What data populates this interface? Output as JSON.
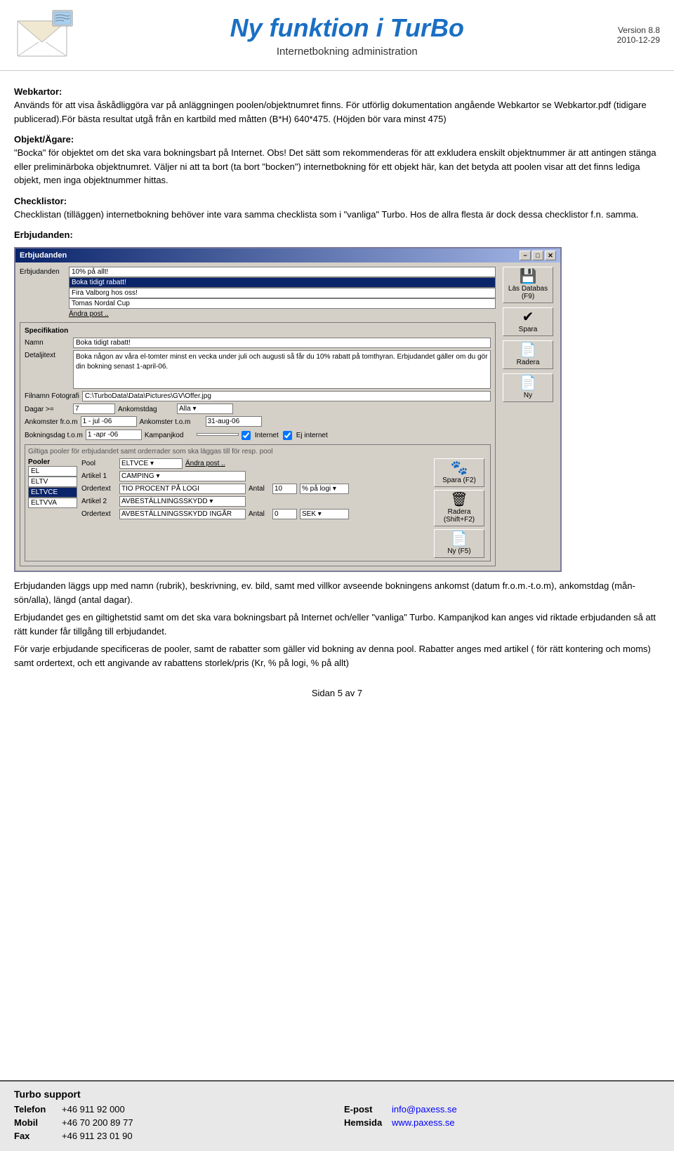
{
  "header": {
    "title": "Ny funktion i TurBo",
    "subtitle": "Internetbokning administration",
    "version_label": "Version 8.8",
    "version_date": "2010-12-29"
  },
  "intro": {
    "webkartor_heading": "Webkartor:",
    "webkartor_p1": "Används för att visa åskådliggöra var på anläggningen poolen/objektnumret finns. För utförlig dokumentation angående Webkartor se Webkartor.pdf (tidigare publicerad).För bästa resultat utgå från en kartbild med måtten (B*H) 640*475. (Höjden bör vara minst 475)",
    "objekt_heading": "Objekt/Ägare:",
    "objekt_p1": "\"Bocka\" för objektet om det ska vara bokningsbart på Internet. Obs! Det sätt som rekommenderas för att exkludera enskilt objektnummer är att antingen stänga eller preliminärboka objektnumret. Väljer ni att ta bort (ta bort \"bocken\") internetbokning för ett objekt här, kan det betyda att poolen visar att det finns lediga objekt, men inga objektnummer hittas.",
    "checklistor_heading": "Checklistor:",
    "checklistor_p1": "Checklistan (tilläggen) internetbokning behöver inte vara samma checklista som i \"vanliga\" Turbo. Hos de allra flesta är dock dessa checklistor f.n. samma.",
    "erbjudanden_heading": "Erbjudanden:"
  },
  "dialog": {
    "title": "Erbjudanden",
    "titlebar_minimize": "−",
    "titlebar_maximize": "□",
    "titlebar_close": "✕",
    "erbjudanden_label": "Erbjudanden",
    "list_items": [
      {
        "text": "10% på allt!",
        "selected": false
      },
      {
        "text": "Boka tidigt rabatt!",
        "selected": true
      },
      {
        "text": "Fira Valborg hos oss!",
        "selected": false
      },
      {
        "text": "Tomas Nordal Cup",
        "selected": false
      }
    ],
    "andrapost": "Ändra post ..",
    "spec_heading": "Specifikation",
    "spec_namn_label": "Namn",
    "spec_namn_value": "Boka tidigt rabatt!",
    "spec_detalj_label": "Detaljitext",
    "spec_detalj_value": "Boka någon av våra el-tomter minst en vecka under juli och augusti så får du 10% rabatt på tomthyran. Erbjudandet gäller om du gör din bokning senast 1-april-06.",
    "spec_filnamn_label": "Filnamn Fotografi",
    "spec_filnamn_value": "C:\\TurboData\\Data\\Pictures\\GV\\Offer.jpg",
    "spec_dagar_label": "Dagar >=",
    "spec_dagar_value": "7",
    "spec_ankomstdag_label": "Ankomstdag",
    "spec_ankomstdag_value": "Alla",
    "spec_ankomst_from_label": "Ankomster fr.o.m",
    "spec_ankomst_from_value": "1 - jul -06",
    "spec_ankomst_tom_label": "Ankomster t.o.m",
    "spec_ankomst_tom_value": "31-aug-06",
    "spec_bokdag_label": "Bokningsdag t.o.m",
    "spec_bokdag_value": "1 -apr -06",
    "spec_kampanj_label": "Kampanjkod",
    "spec_kampanj_value": "",
    "spec_internet_label": "Internet",
    "spec_ejinternet_label": "Ej internet",
    "btn_las_label": "Läs Databas (F9)",
    "btn_spara_label": "Spara",
    "btn_radera_label": "Radera",
    "btn_ny_label": "Ny",
    "pooler_info": "Giltiga pooler för erbjudandet samt orderrader som ska läggas till för resp. pool",
    "pooler_heading": "Pooler",
    "pooler_items": [
      {
        "text": "EL",
        "selected": false
      },
      {
        "text": "ELTV",
        "selected": false
      },
      {
        "text": "ELTVCE",
        "selected": true
      },
      {
        "text": "ELTVVA",
        "selected": false
      }
    ],
    "pool_label": "Pool",
    "pool_value": "ELTVCE",
    "pool_andra": "Ändra post ..",
    "artikel1_label": "Artikel 1",
    "artikel1_value": "CAMPING",
    "ordertext1_label": "Ordertext",
    "ordertext1_value": "TIO PROCENT PÅ LOGI",
    "antal1_label": "Antal",
    "antal1_value": "10",
    "pct1_value": "% på logi",
    "artikel2_label": "Artikel 2",
    "artikel2_value": "AVBESTÄLLNINGSSKYDD",
    "ordertext2_label": "Ordertext",
    "ordertext2_value": "AVBESTÄLLNINGSSKYDD INGÅR",
    "antal2_label": "Antal",
    "antal2_value": "0",
    "sek2_value": "SEK",
    "btn_spara2_label": "Spara (F2)",
    "btn_radera2_label": "Radera (Shift+F2)",
    "btn_ny2_label": "Ny (F5)"
  },
  "after_dialog": {
    "p1": "Erbjudanden läggs upp med namn (rubrik), beskrivning, ev. bild, samt med villkor avseende bokningens ankomst (datum fr.o.m.-t.o.m), ankomstdag (mån-sön/alla), längd (antal dagar).",
    "p2": "Erbjudandet ges en giltighetstid samt om det ska vara bokningsbart på Internet och/eller \"vanliga\" Turbo. Kampanjkod kan anges vid riktade erbjudanden så att rätt kunder får tillgång till erbjudandet.",
    "p3": "För varje erbjudande specificeras de pooler, samt de rabatter som gäller vid bokning av denna pool. Rabatter anges med artikel ( för rätt kontering och moms) samt ordertext, och ett angivande av rabattens storlek/pris (Kr, % på logi, % på allt)"
  },
  "page_number": "Sidan 5 av 7",
  "footer": {
    "company": "Turbo support",
    "telefon_label": "Telefon",
    "telefon_value": "+46 911 92 000",
    "mobil_label": "Mobil",
    "mobil_value": "+46 70 200 89 77",
    "fax_label": "Fax",
    "fax_value": "+46 911 23 01 90",
    "epost_label": "E-post",
    "epost_value": "info@paxess.se",
    "hemsida_label": "Hemsida",
    "hemsida_value": "www.paxess.se"
  }
}
